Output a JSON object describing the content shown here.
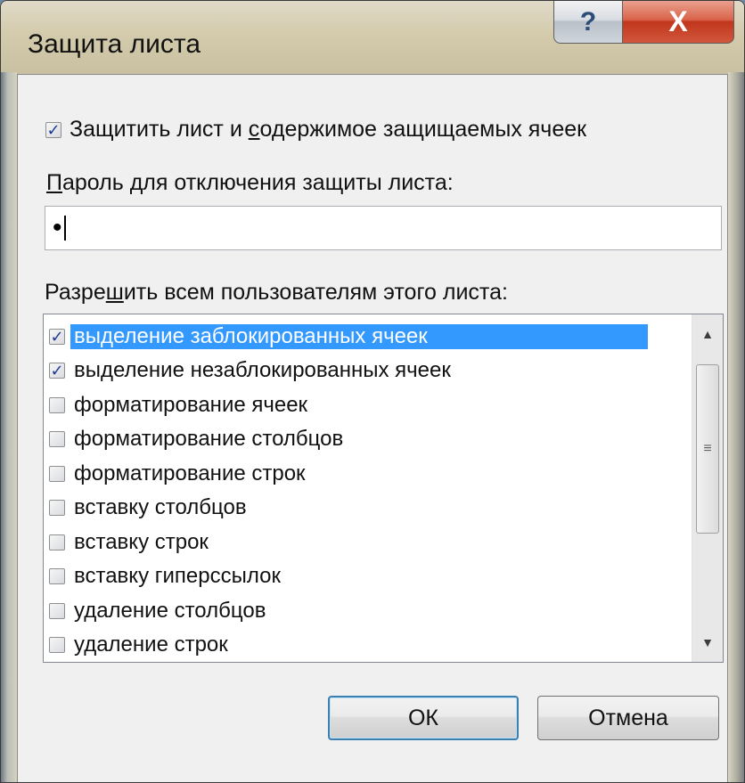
{
  "window": {
    "title": "Защита листа",
    "help_glyph": "?",
    "close_glyph": "X"
  },
  "protect": {
    "checked": true,
    "label_before": "Защитить лист и ",
    "label_underlined": "с",
    "label_after": "одержимое защищаемых ячеек"
  },
  "password": {
    "label_underlined": "П",
    "label_after": "ароль для отключения защиты листа:",
    "value": "•"
  },
  "allow": {
    "label_before": "Разре",
    "label_underlined": "ш",
    "label_after": "ить всем пользователям этого листа:",
    "items": [
      {
        "label": "выделение заблокированных ячеек",
        "checked": true,
        "selected": true
      },
      {
        "label": "выделение незаблокированных ячеек",
        "checked": true,
        "selected": false
      },
      {
        "label": "форматирование ячеек",
        "checked": false,
        "selected": false
      },
      {
        "label": "форматирование столбцов",
        "checked": false,
        "selected": false
      },
      {
        "label": "форматирование строк",
        "checked": false,
        "selected": false
      },
      {
        "label": "вставку столбцов",
        "checked": false,
        "selected": false
      },
      {
        "label": "вставку строк",
        "checked": false,
        "selected": false
      },
      {
        "label": "вставку гиперссылок",
        "checked": false,
        "selected": false
      },
      {
        "label": "удаление столбцов",
        "checked": false,
        "selected": false
      },
      {
        "label": "удаление строк",
        "checked": false,
        "selected": false
      }
    ]
  },
  "buttons": {
    "ok": "ОК",
    "cancel": "Отмена"
  },
  "colors": {
    "selection": "#3399ff",
    "check": "#1f3a93",
    "close_button": "#c1361c"
  },
  "icons": {
    "help": "help-icon",
    "close": "close-icon",
    "check": "checkmark-icon",
    "scroll_up": "arrow-up-icon",
    "scroll_down": "arrow-down-icon",
    "grip": "scroll-grip-icon"
  }
}
